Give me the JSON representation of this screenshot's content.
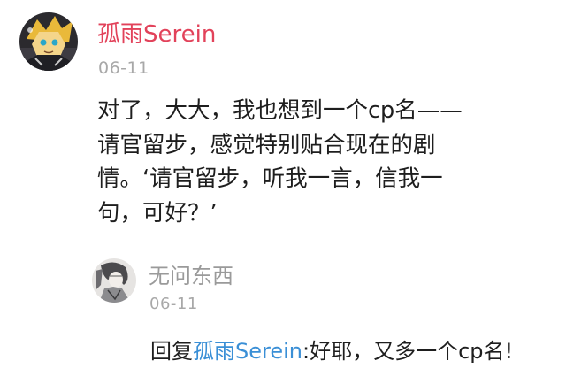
{
  "comment": {
    "username": "孤雨Serein",
    "date": "06-11",
    "lines": [
      "对了，大大，我也想到一个cp名——",
      "请官留步，感觉特别贴合现在的剧",
      "情。‘请官留步，听我一言，信我一",
      "句，可好？’"
    ]
  },
  "reply": {
    "username": "无问东西",
    "date": "06-11",
    "prefix": "回复",
    "mention": "孤雨Serein",
    "separator": ":",
    "text": "好耶，又多一个cp名!"
  },
  "colors": {
    "username_main": "#e2425a",
    "mention": "#3a8fd6",
    "muted": "#a8a8a8"
  }
}
